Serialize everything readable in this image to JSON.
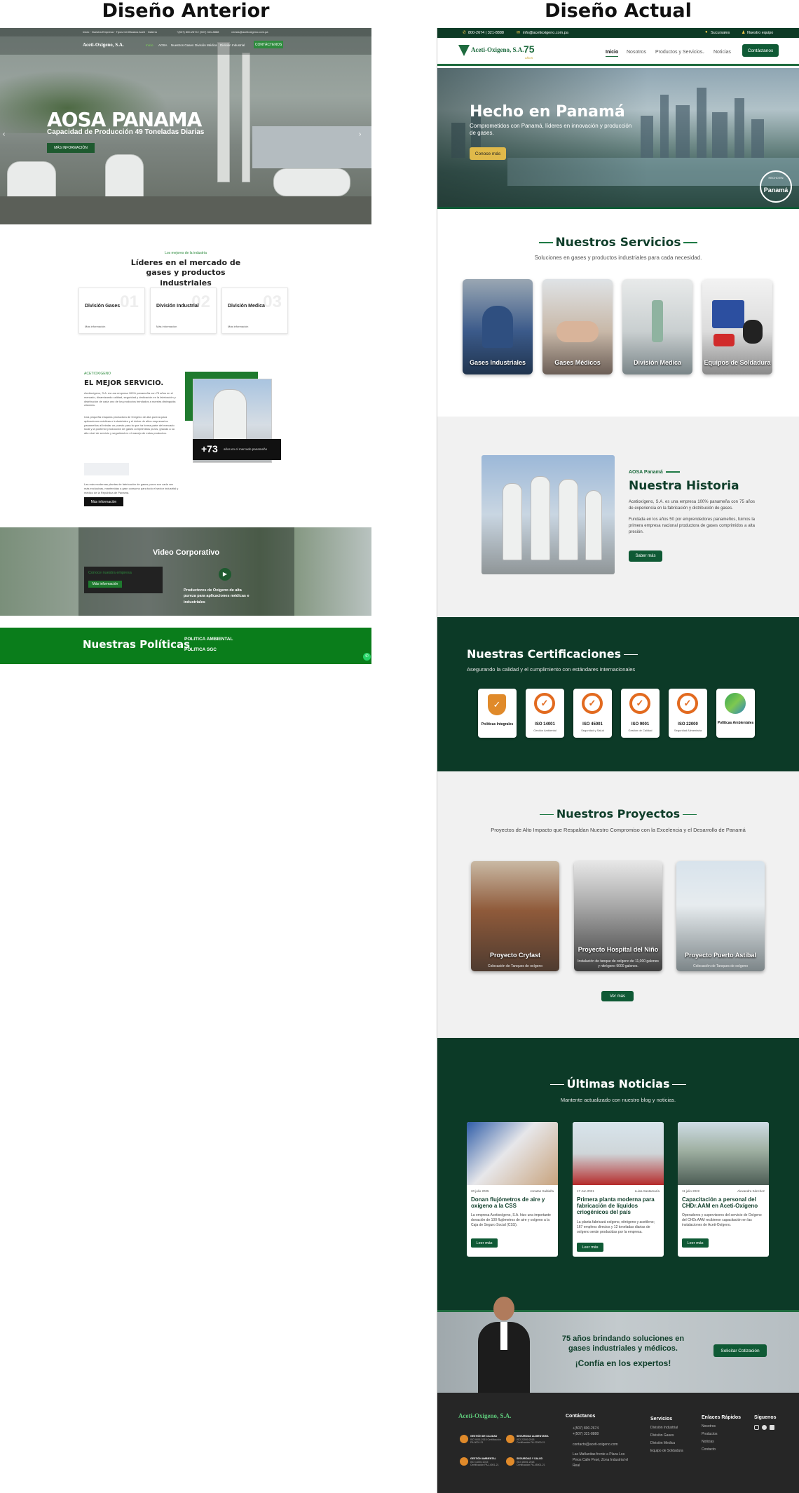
{
  "headings": {
    "left": "Diseño Anterior",
    "right": "Diseño Actual"
  },
  "old": {
    "topbar": "Inicio · Nuestra Empresa · Tipos Certificados Aceti · Galería",
    "topbar_contact": "+(507) 800-2674 / (507) 321-8888",
    "topbar_email": "ventas@acetioxigeno.com.pa",
    "logo": "Aceti-Oxigeno, S.A.",
    "nav": [
      "Inicio",
      "AOSA",
      "Nuestros Gases",
      "División Médica",
      "División Industrial"
    ],
    "contact_btn": "CONTÁCTENOS",
    "hero_title": "AOSA PANAMA",
    "hero_sub": "Capacidad de Producción 49 Toneladas Diarias",
    "hero_btn": "MÁS INFORMACIÓN",
    "eyebrow": "Los mejores de la industria",
    "leaders_title": "Líderes en el mercado de gases y productos industriales",
    "cards": [
      {
        "title": "División Gases",
        "num": "01",
        "more": "Más información"
      },
      {
        "title": "División Industrial",
        "num": "02",
        "more": "Más información"
      },
      {
        "title": "División Medica",
        "num": "03",
        "more": "Más información"
      }
    ],
    "about_eyebrow": "ACETIOXIGENO",
    "about_title": "EL MEJOR SERVICIO.",
    "about_p1": "Acetioxígeno, S.A. es una empresa 100% panameña con 75 años en el mercado, dinamizando calidad, seguridad y dedicación en la fabricación y distribución de cada uno de los productos brindados a nuestra distinguida clientela.",
    "about_p2": "Una pequeña máquina productora de Oxígeno de alta pureza para aplicaciones médicas e industriales y el deber de altos empresarios panameños al brindar un puesto para la que ha forma parte del mercado local y la posterior producción de gases comprimidos puros, gracias a su alto nivel de servicio y seguridad en el manejo de estos productos.",
    "about_p3": "Las más modernas plantas de fabricación de gases puros son cada vez más exclusivas, mantenidas a gran consumo para todo el sector industrial y médico de la República de Panamá.",
    "about_btn": "Más información",
    "stat_num": "+73",
    "stat_text": "años en el mercado panameño",
    "video_title": "Video Corporativo",
    "video_box_title": "Conoce nuestra empresa",
    "video_box_btn": "Más información",
    "video_caption": "Productores de Oxígeno de alta pureza para aplicaciones médicas e industriales",
    "policies_title": "Nuestras Políticas",
    "policies": [
      "POLITICA AMBIENTAL",
      "POLITICA SGC"
    ]
  },
  "new": {
    "topbar_phone": "800-2674 | 321-8888",
    "topbar_email": "info@acetioxigeno.com.pa",
    "topbar_links": [
      "Sucursales",
      "Nuestro equipo"
    ],
    "logo": "Aceti-Oxigeno, S.A.",
    "logo_years": "75",
    "logo_years_sub": "AÑOS",
    "nav": [
      "Inicio",
      "Nosotros",
      "Productos y Servicios",
      "Noticias"
    ],
    "nav_btn": "Contáctanos",
    "hero_title": "Hecho en Panamá",
    "hero_text": "Comprometidos con Panamá, líderes en innovación y producción de gases.",
    "hero_btn": "Conoce más",
    "hero_seal_top": "HECHO EN",
    "hero_seal": "Panamá",
    "services_title": "Nuestros Servicios",
    "services_sub": "Soluciones en gases y productos industriales para cada necesidad.",
    "services": [
      "Gases Industriales",
      "Gases Médicos",
      "División Medica",
      "Equipos de Soldadura"
    ],
    "history_eyebrow": "AOSA Panamá",
    "history_title": "Nuestra Historia",
    "history_p1": "Acetioxígeno, S.A. es una empresa 100% panameña con 75 años de experiencia en la fabricación y distribución de gases.",
    "history_p2": "Fundada en los años 50 por emprendedores panameños, fuimos la primera empresa nacional productora de gases comprimidos a alta presión.",
    "history_btn": "Saber más",
    "cert_title": "Nuestras Certificaciones",
    "cert_sub": "Asegurando la calidad y el cumplimiento con estándares internacionales",
    "certs": [
      {
        "title": "Políticas Integrales",
        "sub": ""
      },
      {
        "title": "ISO 14001",
        "sub": "Gestión Ambiental"
      },
      {
        "title": "ISO 45001",
        "sub": "Seguridad y Salud"
      },
      {
        "title": "ISO 9001",
        "sub": "Gestión de Calidad"
      },
      {
        "title": "ISO 22000",
        "sub": "Seguridad Alimentaria"
      },
      {
        "title": "Políticas Ambientales",
        "sub": ""
      }
    ],
    "projects_title": "Nuestros Proyectos",
    "projects_sub": "Proyectos de Alto Impacto que Respaldan Nuestro Compromiso con la Excelencia y el Desarrollo de Panamá",
    "projects": [
      {
        "title": "Proyecto Cryfast",
        "sub": "Colocación de Tanques de oxígeno"
      },
      {
        "title": "Proyecto Hospital del Niño",
        "sub": "Instalación de tanque de oxígeno de 11,000 galones y nitrógeno 9000 galones."
      },
      {
        "title": "Proyecto Puerto Astibal",
        "sub": "Colocación de Tanques de oxígeno"
      }
    ],
    "projects_btn": "Ver más",
    "news_title": "Últimas Noticias",
    "news_sub": "Mantente actualizado con nuestro blog y noticias.",
    "news": [
      {
        "date": "20 julio 2025",
        "author": "Jonatan Saldaña",
        "title": "Donan flujómetros de aire y oxígeno a la CSS",
        "text": "La empresa Acetioxígeno, S.A. hizo una importante donación de 100 flujómetros de aire y oxígeno a la Caja de Seguro Social (CSS).",
        "btn": "Leer más"
      },
      {
        "date": "17 Jun 2021",
        "author": "Luisa Santamaría",
        "title": "Primera planta moderna para fabricación de líquidos criogénicos del país",
        "text": "La planta fabricará oxígeno, nitrógeno y acetileno; 167 empleos directos y 12 toneladas diarias de oxígeno serán producidas por la empresa.",
        "btn": "Leer más"
      },
      {
        "date": "11 julio 2022",
        "author": "Alexandra Sánchez",
        "title": "Capacitación a personal del CHDr.AAM en Aceti-Oxígeno",
        "text": "Operadores y supervisores del servicio de Oxígeno del CHDr.AAM recibieron capacitación en las instalaciones de Aceti-Oxígeno.",
        "btn": "Leer más"
      }
    ],
    "cta_line1": "75 años brindando soluciones en",
    "cta_line2": "gases industriales y médicos.",
    "cta_line3": "¡Confía en los expertos!",
    "cta_btn": "Solicitar Cotización",
    "footer_logo": "Aceti-Oxigeno, S.A.",
    "footer_badges": [
      {
        "title": "GESTIÓN DE CALIDAD",
        "sub": "ISO 9001:2015 Certificación PA-9001-21"
      },
      {
        "title": "SEGURIDAD ALIMENTARIA",
        "sub": "ISO 22000:2018 Certificación PA-22000-21"
      },
      {
        "title": "GESTIÓN AMBIENTAL",
        "sub": "ISO 14001:2015 Certificación PA-14001-21"
      },
      {
        "title": "SEGURIDAD Y SALUD",
        "sub": "ISO 45001:2018 Certificación PA-45001-21"
      }
    ],
    "footer_contact_title": "Contáctanos",
    "footer_contact": [
      "+(507) 800-2674",
      "+(507) 321-8888",
      "contacto@aceti-oxigeno.com",
      "Las Mañanitas frente a Plaza Los Pinos Calle Pesé, Zona Industrial el Real"
    ],
    "footer_services_title": "Servicios",
    "footer_services": [
      "División Industrial",
      "División Gases",
      "División Medica",
      "Equipo de Soldadura"
    ],
    "footer_links_title": "Enlaces Rápidos",
    "footer_links": [
      "Nosotros",
      "Productos",
      "Noticias",
      "Contacto"
    ],
    "footer_follow_title": "Síguenos"
  }
}
